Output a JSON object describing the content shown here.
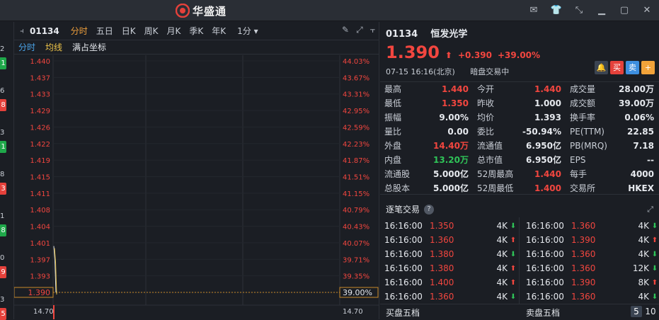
{
  "app": {
    "title": "华盛通"
  },
  "left_strip": [
    {
      "n": "2",
      "tag": "1",
      "color": "g"
    },
    {
      "n": "6",
      "tag": "8",
      "color": "r"
    },
    {
      "n": "3",
      "tag": "1",
      "color": "g"
    },
    {
      "n": "8",
      "tag": "3",
      "color": "r"
    },
    {
      "n": "1",
      "tag": "8",
      "color": "g"
    },
    {
      "n": "0",
      "tag": "9",
      "color": "r"
    },
    {
      "n": "3",
      "tag": "5",
      "color": "r"
    }
  ],
  "toolbar": {
    "code": "01134",
    "periods": [
      "分时",
      "五日",
      "日K",
      "周K",
      "月K",
      "季K",
      "年K"
    ],
    "active_period": "分时",
    "minute": "1分 ▾"
  },
  "subtabs": {
    "t1": "分时",
    "t2": "均线",
    "t3": "满占坐标"
  },
  "chart_data": {
    "type": "line",
    "left_ticks": [
      "1.440",
      "1.437",
      "1.433",
      "1.429",
      "1.426",
      "1.422",
      "1.419",
      "1.415",
      "1.411",
      "1.408",
      "1.404",
      "1.401",
      "1.397",
      "1.393",
      "1.390"
    ],
    "right_ticks": [
      "44.03%",
      "43.67%",
      "43.31%",
      "42.95%",
      "42.59%",
      "42.23%",
      "41.87%",
      "41.51%",
      "41.15%",
      "40.79%",
      "40.43%",
      "40.07%",
      "39.71%",
      "39.35%",
      "39.00%"
    ],
    "bottom_left": "14.70",
    "bottom_right": "14.70",
    "ylim": [
      1.39,
      1.44
    ],
    "current": "1.390",
    "series": [
      {
        "values": [
          1.4,
          1.397,
          1.39
        ]
      }
    ]
  },
  "quote": {
    "code": "01134",
    "name": "恒发光学",
    "price": "1.390",
    "change": "+0.390",
    "change_pct": "+39.00%",
    "arrow": "⬆",
    "date": "07-15",
    "time": "16:16(北京)",
    "status": "暗盘交易中",
    "btn_buy": "买",
    "btn_sell": "卖",
    "btn_add": "+",
    "rows": [
      [
        [
          "最高",
          "1.440",
          "red"
        ],
        [
          "今开",
          "1.440",
          "red"
        ],
        [
          "成交量",
          "28.00万",
          ""
        ]
      ],
      [
        [
          "最低",
          "1.350",
          "red"
        ],
        [
          "昨收",
          "1.000",
          ""
        ],
        [
          "成交额",
          "39.00万",
          ""
        ]
      ],
      [
        [
          "振幅",
          "9.00%",
          ""
        ],
        [
          "均价",
          "1.393",
          ""
        ],
        [
          "换手率",
          "0.06%",
          ""
        ]
      ],
      [
        [
          "量比",
          "0.00",
          ""
        ],
        [
          "委比",
          "-50.94%",
          ""
        ],
        [
          "PE(TTM)",
          "22.85",
          ""
        ]
      ],
      [
        [
          "外盘",
          "14.40万",
          "red"
        ],
        [
          "流通值",
          "6.950亿",
          ""
        ],
        [
          "PB(MRQ)",
          "7.18",
          ""
        ]
      ],
      [
        [
          "内盘",
          "13.20万",
          "green"
        ],
        [
          "总市值",
          "6.950亿",
          ""
        ],
        [
          "EPS",
          "--",
          ""
        ]
      ],
      [
        [
          "流通股",
          "5.000亿",
          ""
        ],
        [
          "52周最高",
          "1.440",
          "red"
        ],
        [
          "每手",
          "4000",
          ""
        ]
      ],
      [
        [
          "总股本",
          "5.000亿",
          ""
        ],
        [
          "52周最低",
          "1.400",
          "red"
        ],
        [
          "交易所",
          "HKEX",
          ""
        ]
      ]
    ]
  },
  "ticks": {
    "title": "逐笔交易",
    "left": [
      [
        "16:16:00",
        "1.350",
        "4K",
        "dn"
      ],
      [
        "16:16:00",
        "1.360",
        "4K",
        "up"
      ],
      [
        "16:16:00",
        "1.380",
        "4K",
        "dn"
      ],
      [
        "16:16:00",
        "1.380",
        "4K",
        "up"
      ],
      [
        "16:16:00",
        "1.400",
        "4K",
        "up"
      ],
      [
        "16:16:00",
        "1.360",
        "4K",
        "dn"
      ]
    ],
    "right": [
      [
        "16:16:00",
        "1.360",
        "4K",
        "dn"
      ],
      [
        "16:16:00",
        "1.390",
        "4K",
        "up"
      ],
      [
        "16:16:00",
        "1.360",
        "4K",
        "dn"
      ],
      [
        "16:16:00",
        "1.360",
        "12K",
        "dn"
      ],
      [
        "16:16:00",
        "1.390",
        "8K",
        "up"
      ],
      [
        "16:16:00",
        "1.360",
        "4K",
        "dn"
      ]
    ]
  },
  "book": {
    "buy": "买盘五档",
    "sell": "卖盘五档",
    "p5": "5",
    "p10": "10"
  }
}
